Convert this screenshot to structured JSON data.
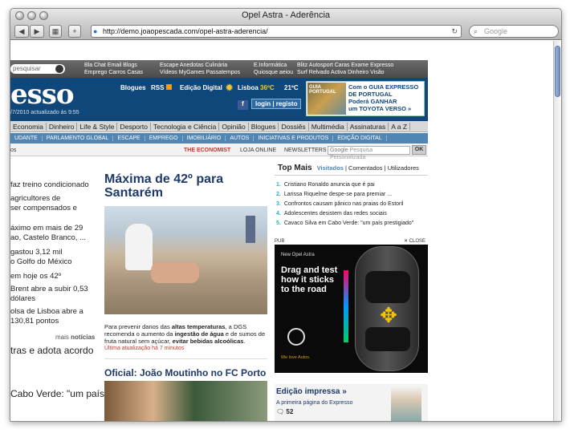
{
  "window": {
    "title": "Opel Astra - Aderência",
    "url": "http://demo.joaopescada.com/opel-astra-aderencia/",
    "search_placeholder": "Google"
  },
  "strip": {
    "search_placeholder": "pesquisar",
    "groups": [
      [
        "Bla Chat",
        "Email",
        "Blogs",
        "Emprego",
        "Carros",
        "Casas"
      ],
      [
        "Escape",
        "Anedotas",
        "Culinária",
        "Vídeos",
        "MyGames",
        "Passatempos"
      ],
      [
        "E.Informática",
        "Quiosque aeiou"
      ],
      [
        "Blitz",
        "Autosport",
        "Caras",
        "Exame",
        "Expresso",
        "Surf",
        "Relvado",
        "Activa",
        "Dinheiro",
        "Visão"
      ]
    ]
  },
  "header": {
    "logo": "esso",
    "date": "/7/2010 actualizado às 9:55",
    "blogues": "Blogues",
    "rss": "RSS",
    "edicao_digital": "Edição Digital",
    "city": "Lisboa",
    "temp_max": "36ºC",
    "temp_min": "21ºC",
    "login": "login | registo",
    "promo": {
      "line1": "Com o GUIA EXPRESSO",
      "line2": "DE PORTUGAL",
      "line3": "Poderá GANHAR",
      "line4": "um TOYOTA VERSO »",
      "img_label": "GUIA PORTUGAL"
    }
  },
  "nav1": [
    "Economia",
    "Dinheiro",
    "Life & Style",
    "Desporto",
    "Tecnologia e Ciência",
    "Opinião",
    "Blogues",
    "Dossiês",
    "Multimédia",
    "Assinaturas",
    "A a Z"
  ],
  "nav2": [
    "UDANTE",
    "PARLAMENTO GLOBAL",
    "ESCAPE",
    "EMPREGO",
    "IMOBILIÁRIO",
    "AUTOS",
    "INICIATIVAS E PRODUTOS",
    "EDIÇÃO DIGITAL"
  ],
  "nav3": {
    "first": "os",
    "economist": "THE ECONOMIST",
    "loja": "LOJA ONLINE",
    "newsletters": "NEWSLETTERS",
    "search_placeholder": "Pesquisa Personalizada",
    "ok": "OK",
    "google": "Google"
  },
  "left": [
    "faz treino condicionado",
    "agricultores de",
    "ser compensados e",
    "áximo em mais de 29",
    "ao, Castelo Branco, ...",
    "gastou 3,12 mil",
    "o Golfo do México",
    "em hoje os 42º",
    "Brent abre a subir 0,53",
    "dólares",
    "olsa de Lisboa abre a",
    "130,81 pontos",
    "tras e adota acordo",
    "Cabo Verde: \"um país"
  ],
  "left_more": {
    "prefix": "mais",
    "bold": "notícias"
  },
  "main": {
    "headline": "Máxima de 42º para Santarém",
    "summary": [
      "Para prevenir danos das ",
      "altas temperaturas",
      ", a DGS recomenda o aumento da ",
      "ingestão de água",
      " e de sumos de fruta natural sem açúcar, ",
      "evitar bebidas alcoólicas",
      "."
    ],
    "updated": "Última atualização há 7 minutos",
    "headline2": "Oficial: João Moutinho no FC Porto"
  },
  "top_mais": {
    "title": "Top Mais",
    "tabs": [
      "Visitados",
      "Comentados",
      "Utilizadores"
    ],
    "items": [
      "Cristiano Ronaldo anuncia que é pai",
      "Larissa Riquelme despe-se para premiar ...",
      "Confrontos causam pânico nas praias do Estoril",
      "Adolescentes desistem das redes sociais",
      "Cavaco Silva em Cabo Verde: \"um país prestigiado\""
    ]
  },
  "ad": {
    "label": "PUB",
    "close": "✕ CLOSE",
    "brand": "New Opel Astra",
    "tagline": [
      "Drag and test",
      "how it sticks",
      "to the road"
    ],
    "footer": "We love Autos.",
    "drag_label": "Drag"
  },
  "edicao": {
    "title": "Edição impressa »",
    "link": "A primeira página do Expresso",
    "comments": "52"
  },
  "colors": {
    "navy": "#10477b",
    "steel": "#4f86b3",
    "cyan": "#1db5c8",
    "red": "#c0392b"
  }
}
